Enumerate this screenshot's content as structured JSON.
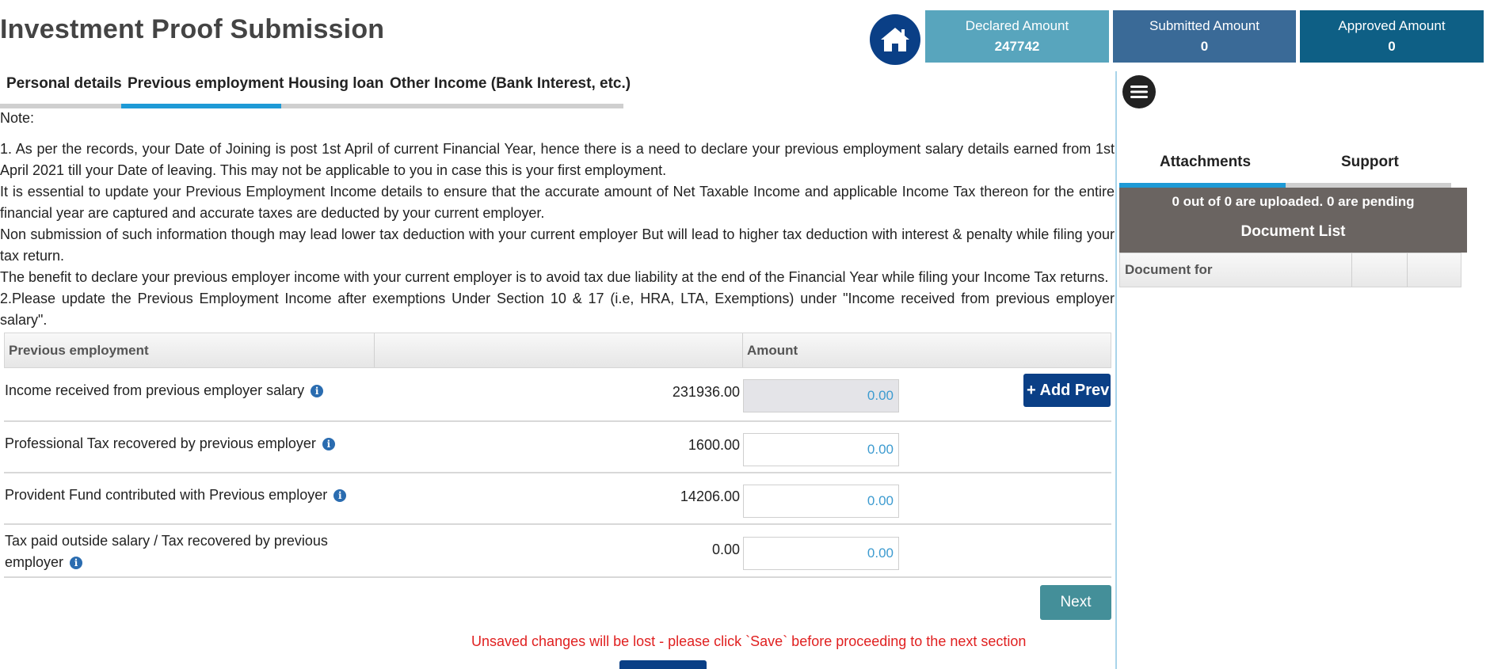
{
  "page": {
    "title": "Investment Proof Submission"
  },
  "stats": {
    "declared": {
      "label": "Declared Amount",
      "value": "247742"
    },
    "submitted": {
      "label": "Submitted Amount",
      "value": "0"
    },
    "approved": {
      "label": "Approved Amount",
      "value": "0"
    }
  },
  "tabs": [
    {
      "label": "Personal details"
    },
    {
      "label": "Previous employment",
      "active": true
    },
    {
      "label": "Housing loan"
    },
    {
      "label": "Other Income (Bank Interest, etc.)"
    }
  ],
  "notes": {
    "heading": "Note:",
    "p1": "1. As per the records, your Date of Joining is post 1st April of current Financial Year, hence there is a need to declare your previous employment salary details earned from 1st April 2021 till your Date of leaving. This may not be applicable to you in case this is your first employment.",
    "p2": "It is essential to update your Previous Employment Income details to ensure that the accurate amount of Net Taxable Income and applicable Income Tax thereon for the entire financial year are captured and accurate taxes are deducted by your current employer.",
    "p3": "Non submission of such information though may lead lower tax deduction with your current employer But will lead to higher tax deduction with interest & penalty while filing your tax return.",
    "p4": "The benefit to declare your previous employer income with your current employer is to avoid tax due liability at the end of the Financial Year while filing your Income Tax returns.",
    "p5": "2.Please update the Previous Employment Income after exemptions Under Section 10 & 17 (i.e, HRA, LTA, Exemptions) under \"Income received from previous employer salary\"."
  },
  "table": {
    "headers": {
      "col1": "Previous employment",
      "col2": "",
      "col3": "Amount"
    },
    "rows": [
      {
        "label": "Income received from previous employer salary",
        "value": "231936.00",
        "input": "0.00"
      },
      {
        "label": "Professional Tax recovered by previous employer",
        "value": "1600.00",
        "input": "0.00"
      },
      {
        "label": "Provident Fund contributed with Previous employer",
        "value": "14206.00",
        "input": "0.00"
      },
      {
        "label": "Tax paid outside salary / Tax recovered by previous employer",
        "value": "0.00",
        "input": "0.00"
      }
    ]
  },
  "buttons": {
    "add_prev": "+ Add Prev",
    "next": "Next"
  },
  "warning": "Unsaved changes will be lost - please click `Save` before proceeding to the next section",
  "sidebar": {
    "tabs": [
      {
        "label": "Attachments",
        "active": true
      },
      {
        "label": "Support"
      }
    ],
    "upload_status": "0 out of 0 are uploaded. 0 are pending",
    "doc_list_title": "Document List",
    "doc_table_header": "Document for"
  },
  "icons": {
    "home": "home-icon",
    "menu": "hamburger-menu-icon",
    "info": "info-icon"
  },
  "colors": {
    "primary_navy": "#0a3f86",
    "tab_active": "#1e9ad6",
    "declared_bg": "#58a5bd",
    "submitted_bg": "#3a6a97",
    "approved_bg": "#0e5f85",
    "next_bg": "#448f99",
    "warning": "#e02020"
  }
}
